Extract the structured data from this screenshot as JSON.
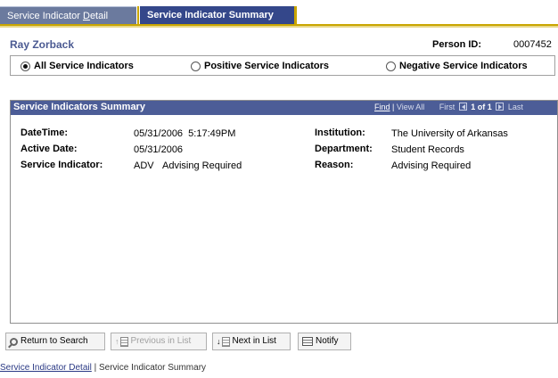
{
  "tabs": {
    "detail_prefix": "Service Indicator ",
    "detail_underlined": "D",
    "detail_suffix": "etail",
    "summary": "Service Indicator Summary"
  },
  "header": {
    "person_name": "Ray Zorback",
    "person_id_label": "Person ID:",
    "person_id_value": "0007452"
  },
  "filters": {
    "all": "All Service Indicators",
    "positive": "Positive Service Indicators",
    "negative": "Negative Service Indicators",
    "selected": "all"
  },
  "summary": {
    "title": "Service Indicators Summary",
    "nav": {
      "find": "Find",
      "separator": " | ",
      "view_all": "View All",
      "first": "First",
      "count": "1 of 1",
      "last": "Last"
    },
    "fields": {
      "datetime_label": "DateTime:",
      "datetime_value": "05/31/2006  5:17:49PM",
      "active_date_label": "Active Date:",
      "active_date_value": "05/31/2006",
      "service_indicator_label": "Service Indicator:",
      "service_indicator_code": "ADV",
      "service_indicator_desc": "Advising Required",
      "institution_label": "Institution:",
      "institution_value": "The University of Arkansas",
      "department_label": "Department:",
      "department_value": "Student Records",
      "reason_label": "Reason:",
      "reason_value": "Advising Required"
    }
  },
  "toolbar": {
    "return_to_search": "Return to Search",
    "previous_in_list": "Previous in List",
    "next_in_list": "Next in List",
    "notify": "Notify"
  },
  "bottom_links": {
    "detail": "Service Indicator Detail",
    "separator": " | ",
    "summary": "Service Indicator Summary"
  },
  "colors": {
    "tab_active": "#34478a",
    "tab_inactive": "#6b7a9e",
    "panel_header": "#4c5d97",
    "accent_gold": "#c9a500",
    "name_text": "#4b5a92"
  }
}
